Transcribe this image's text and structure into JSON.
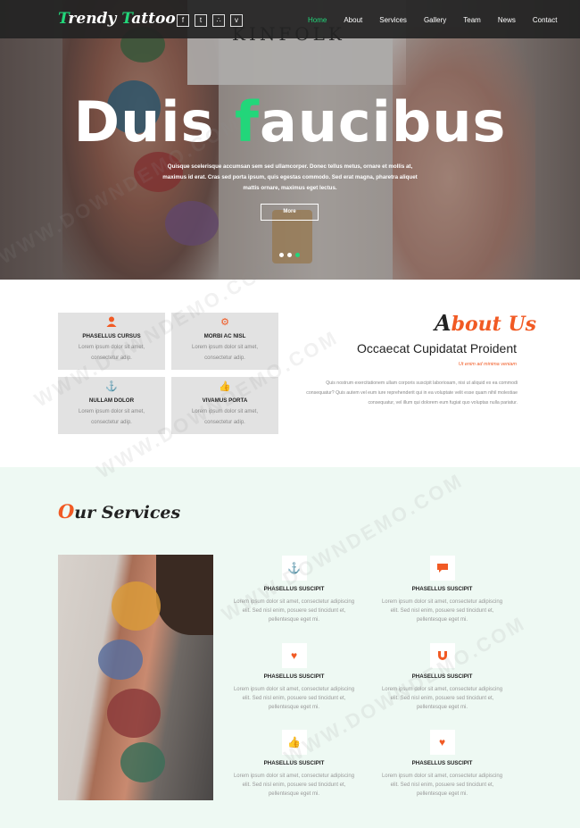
{
  "brand": {
    "logo_first_letter": "T",
    "logo_rest1": "rendy ",
    "logo_second_letter": "T",
    "logo_rest2": "attoo"
  },
  "social_icons": [
    "facebook-icon",
    "twitter-icon",
    "rss-icon",
    "vk-icon"
  ],
  "nav": {
    "items": [
      "Home",
      "About",
      "Services",
      "Gallery",
      "Team",
      "News",
      "Contact"
    ],
    "active": "Home"
  },
  "hero": {
    "book_title": "KINFOLK",
    "title_part1": "Duis ",
    "title_accent": "f",
    "title_part2": "aucibus",
    "subtitle": "Quisque scelerisque accumsan sem sed ullamcorper. Donec tellus metus, ornare et mollis at, maximus id erat. Cras sed porta ipsum, quis egestas commodo. Sed erat magna, pharetra aliquet mattis ornare, maximus eget lectus.",
    "button": "More",
    "slides": 3,
    "active_slide": 3
  },
  "about": {
    "heading_first": "A",
    "heading_rest": "bout Us",
    "subtitle": "Occaecat Cupidatat Proident",
    "tagline": "Ut enim ad minima veniam",
    "body": "Quis nostrum exercitationem ullam corporis suscipit laboriosam, nisi ut aliquid ex ea commodi consequatur? Quis autem vel eum iure reprehenderit qui in ea voluptate velit esse quam nihil molestiae consequatur, vel illum qui dolorem eum fugiat quo voluptas nulla pariatur.",
    "features": [
      {
        "icon": "user-icon",
        "title": "PHASELLUS CURSUS",
        "line1": "Lorem ipsum dolor sit amet,",
        "line2": "consectetur adip."
      },
      {
        "icon": "gear-icon",
        "title": "MORBI AC NISL",
        "line1": "Lorem ipsum dolor sit amet,",
        "line2": "consectetur adip."
      },
      {
        "icon": "anchor-icon",
        "title": "NULLAM DOLOR",
        "line1": "Lorem ipsum dolor sit amet,",
        "line2": "consectetur adip."
      },
      {
        "icon": "thumbs-up-icon",
        "title": "VIVAMUS PORTA",
        "line1": "Lorem ipsum dolor sit amet,",
        "line2": "consectetur adip."
      }
    ]
  },
  "services": {
    "heading_first": "O",
    "heading_rest": "ur Services",
    "items": [
      {
        "icon": "anchor-icon",
        "title": "PHASELLUS SUSCIPIT",
        "l1": "Lorem ipsum dolor sit amet, consectetur adipiscing",
        "l2": "elit. Sed nisl enim, posuere sed tincidunt et,",
        "l3": "pellentesque eget mi."
      },
      {
        "icon": "chat-bubble-icon",
        "title": "PHASELLUS SUSCIPIT",
        "l1": "Lorem ipsum dolor sit amet, consectetur adipiscing",
        "l2": "elit. Sed nisl enim, posuere sed tincidunt et,",
        "l3": "pellentesque eget mi."
      },
      {
        "icon": "heart-pulse-icon",
        "title": "PHASELLUS SUSCIPIT",
        "l1": "Lorem ipsum dolor sit amet, consectetur adipiscing",
        "l2": "elit. Sed nisl enim, posuere sed tincidunt et,",
        "l3": "pellentesque eget mi."
      },
      {
        "icon": "magnet-icon",
        "title": "PHASELLUS SUSCIPIT",
        "l1": "Lorem ipsum dolor sit amet, consectetur adipiscing",
        "l2": "elit. Sed nisl enim, posuere sed tincidunt et,",
        "l3": "pellentesque eget mi."
      },
      {
        "icon": "thumbs-up-icon",
        "title": "PHASELLUS SUSCIPIT",
        "l1": "Lorem ipsum dolor sit amet, consectetur adipiscing",
        "l2": "elit. Sed nisl enim, posuere sed tincidunt et,",
        "l3": "pellentesque eget mi."
      },
      {
        "icon": "heart-pulse-icon",
        "title": "PHASELLUS SUSCIPIT",
        "l1": "Lorem ipsum dolor sit amet, consectetur adipiscing",
        "l2": "elit. Sed nisl enim, posuere sed tincidunt et,",
        "l3": "pellentesque eget mi."
      }
    ]
  },
  "watermark": "WWW.DOWNDEMO.COM",
  "colors": {
    "accent_green": "#22d67a",
    "accent_orange": "#f15a24",
    "navbar": "#232323",
    "services_bg": "#eef9f3"
  }
}
